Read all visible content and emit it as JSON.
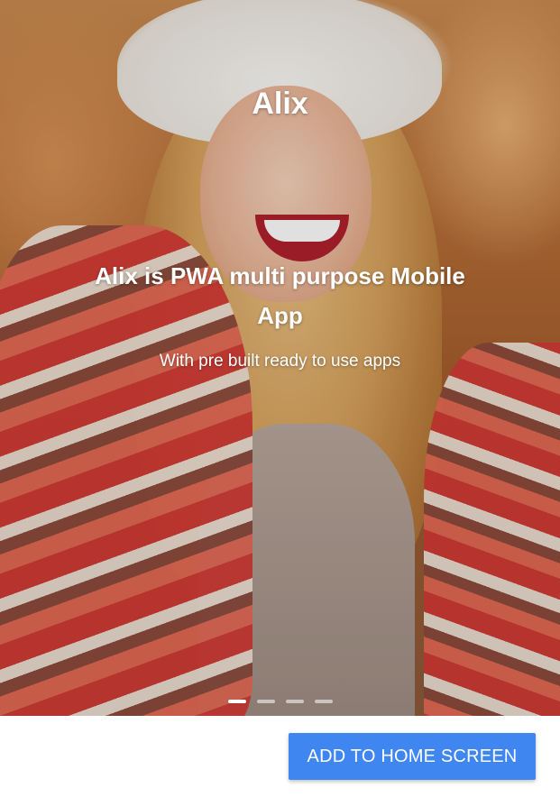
{
  "app": {
    "title": "Alix"
  },
  "slide": {
    "headline": "Alix is PWA multi purpose Mobile App",
    "subtitle": "With pre built ready to use apps"
  },
  "pagination": {
    "active_index": 0,
    "count": 4
  },
  "actions": {
    "add_to_home_label": "ADD TO HOME SCREEN"
  },
  "colors": {
    "button_bg": "#3f86f0",
    "text_on_image": "#ffffff"
  }
}
